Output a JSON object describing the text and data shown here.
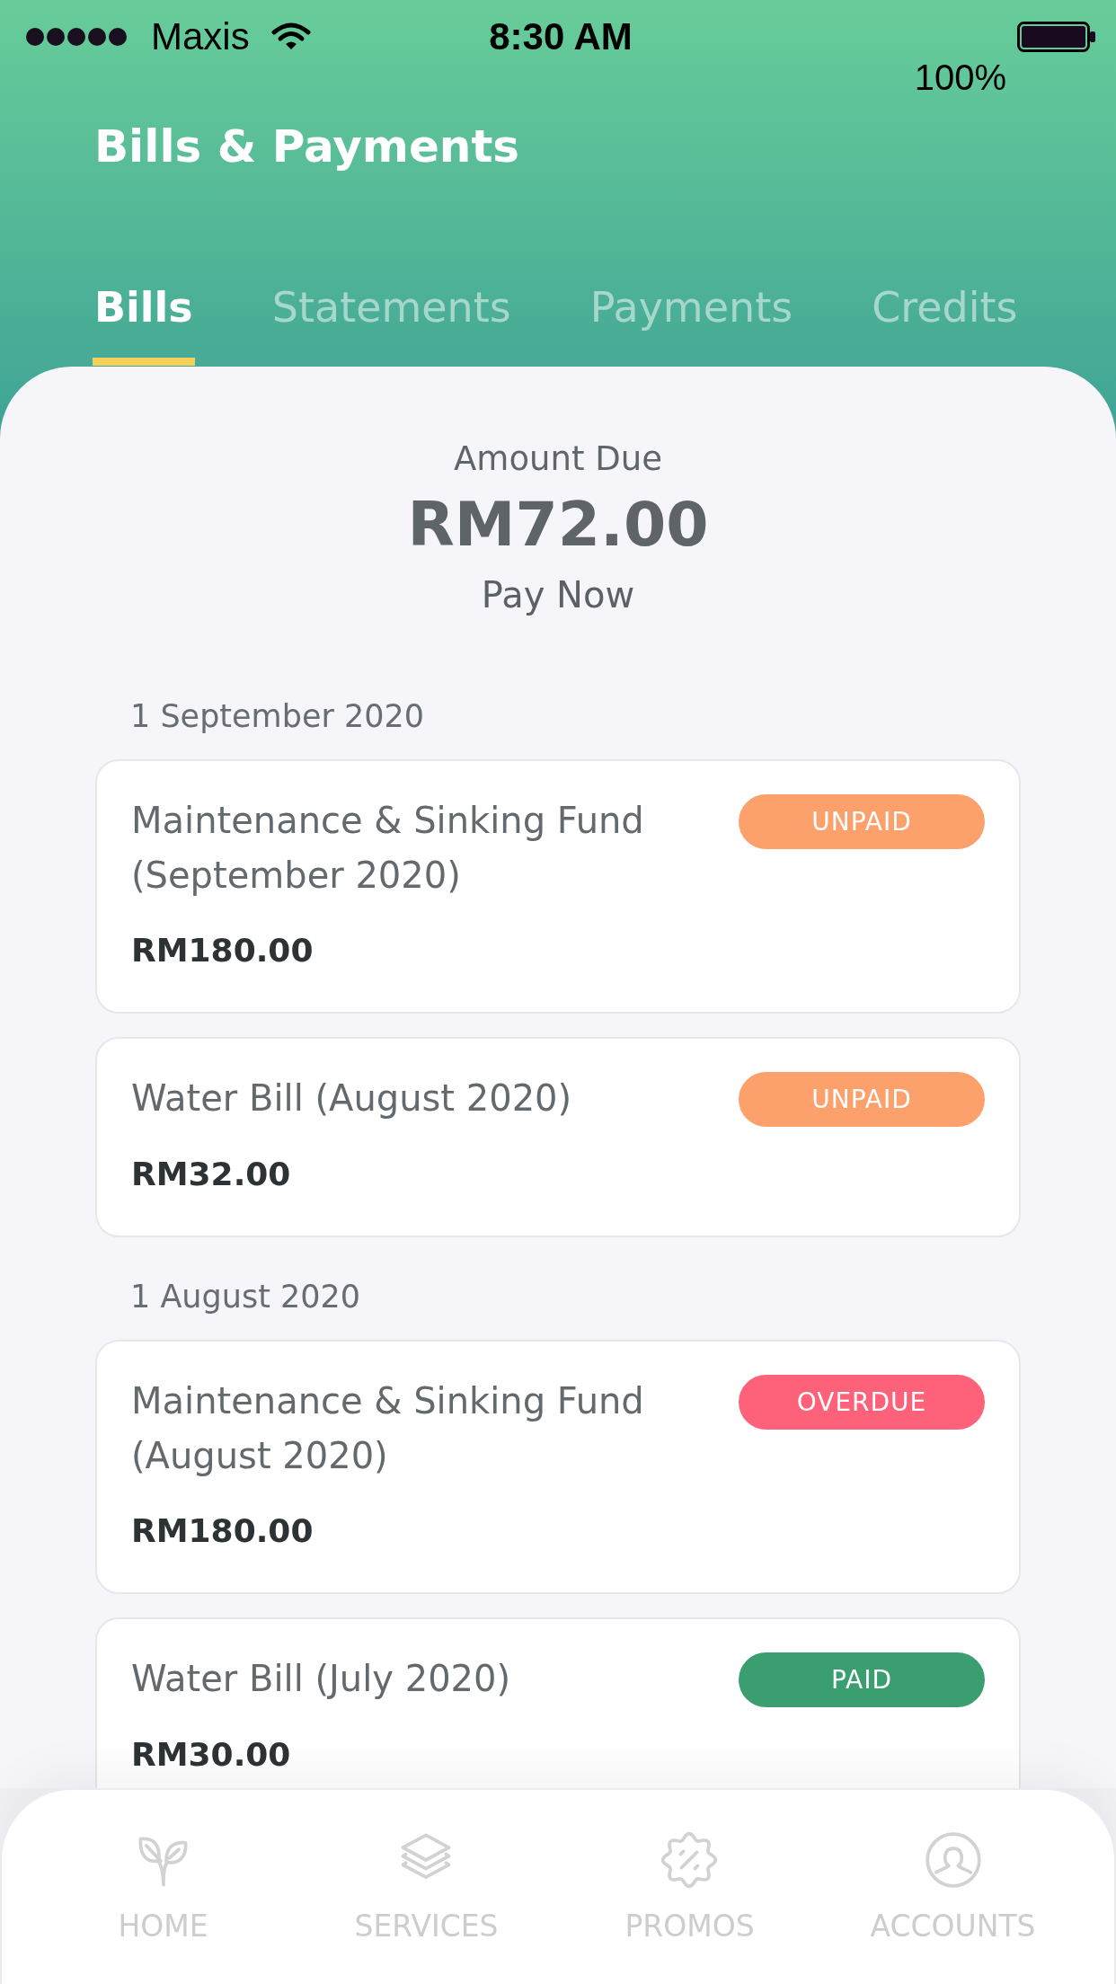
{
  "status_bar": {
    "carrier": "Maxis",
    "time": "8:30 AM",
    "battery": "100%"
  },
  "header": {
    "title": "Bills & Payments"
  },
  "tabs": [
    {
      "label": "Bills",
      "selected": true
    },
    {
      "label": "Statements",
      "selected": false
    },
    {
      "label": "Payments",
      "selected": false
    },
    {
      "label": "Credits",
      "selected": false
    }
  ],
  "amount_due": {
    "label": "Amount Due",
    "amount": "RM72.00",
    "action": "Pay Now"
  },
  "bill_groups": [
    {
      "date": "1 September 2020",
      "bills": [
        {
          "title": "Maintenance & Sinking Fund (September 2020)",
          "amount": "RM180.00",
          "status": "UNPAID",
          "color": "#fda16c"
        },
        {
          "title": "Water Bill (August 2020)",
          "amount": "RM32.00",
          "status": "UNPAID",
          "color": "#fda16c"
        }
      ]
    },
    {
      "date": "1 August 2020",
      "bills": [
        {
          "title": "Maintenance & Sinking Fund (August 2020)",
          "amount": "RM180.00",
          "status": "OVERDUE",
          "color": "#fe627a"
        },
        {
          "title": "Water Bill (July 2020)",
          "amount": "RM30.00",
          "status": "PAID",
          "color": "#3a9e71"
        }
      ]
    }
  ],
  "bottom_nav": [
    {
      "label": "HOME"
    },
    {
      "label": "SERVICES"
    },
    {
      "label": "PROMOS"
    },
    {
      "label": "ACCOUNTS"
    }
  ]
}
